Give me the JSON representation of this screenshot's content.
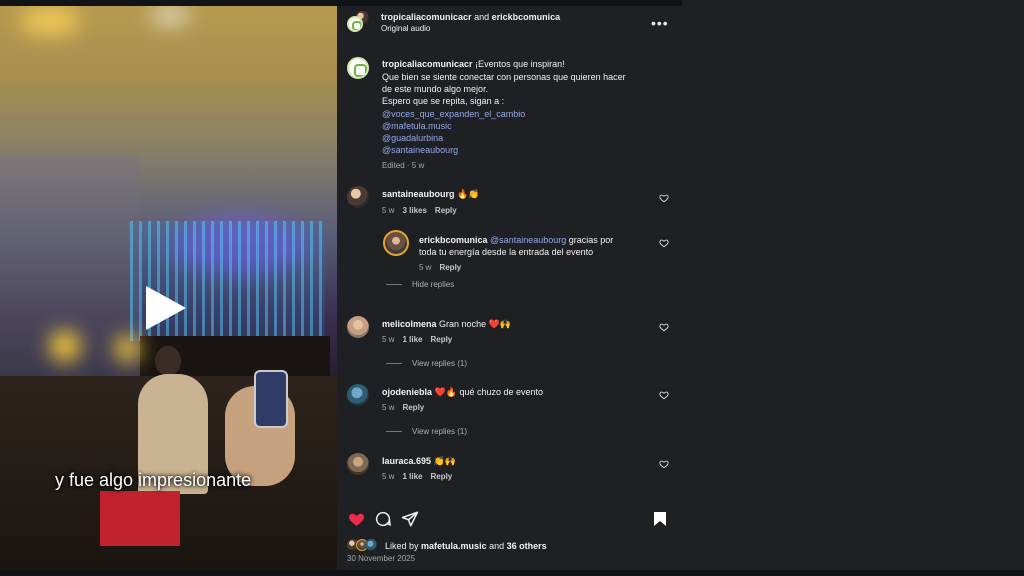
{
  "video": {
    "caption": "y fue algo impresionante"
  },
  "header": {
    "author": "tropicaliacomunicacr",
    "connector": "and",
    "coauthor": "erickbcomunica",
    "audio": "Original audio",
    "more_icon": "more-horizontal-icon"
  },
  "post": {
    "username": "tropicaliacomunicacr",
    "lines": [
      "¡Eventos que inspiran!",
      "Que bien se siente conectar con personas que quieren hacer",
      "de este mundo algo mejor.",
      "Espero que se repita, sigan a :"
    ],
    "mentions": [
      "@voces_que_expanden_el_cambio",
      "@mafetula.music",
      "@guadalurbina",
      "@santaineaubourg"
    ],
    "meta": "Edited · 5 w"
  },
  "comments": [
    {
      "username": "santaineaubourg",
      "text": "🔥👏",
      "age": "5 w",
      "likes": "3 likes",
      "reply": "Reply"
    },
    {
      "username": "erickbcomunica",
      "mention": "@santaineaubourg",
      "text1": "gracias por",
      "text2": "toda tu energía desde la entrada del evento",
      "age": "5 w",
      "reply": "Reply"
    },
    {
      "username": "melicolmena",
      "text": "Gran noche ❤️🙌",
      "age": "5 w",
      "likes": "1 like",
      "reply": "Reply"
    },
    {
      "username": "ojodeniebla",
      "text": "❤️🔥 qué chuzo de evento",
      "age": "5 w",
      "reply": "Reply"
    },
    {
      "username": "lauraca.695",
      "text": "👏🙌",
      "age": "5 w",
      "likes": "1 like",
      "reply": "Reply"
    }
  ],
  "threads": {
    "hide_replies": "Hide replies",
    "view_replies_1": "View replies (1)",
    "view_replies_2": "View replies (1)"
  },
  "actions": {
    "like_icon": "heart-filled-icon",
    "comment_icon": "comment-icon",
    "share_icon": "share-icon",
    "save_icon": "bookmark-icon"
  },
  "likes": {
    "prefix": "Liked by",
    "user": "mafetula.music",
    "connector": "and",
    "others": "36 others"
  },
  "date": "30 November 2025",
  "colors": {
    "like": "#ef2a4a",
    "link": "#93a8e8",
    "background": "#1f2024"
  }
}
